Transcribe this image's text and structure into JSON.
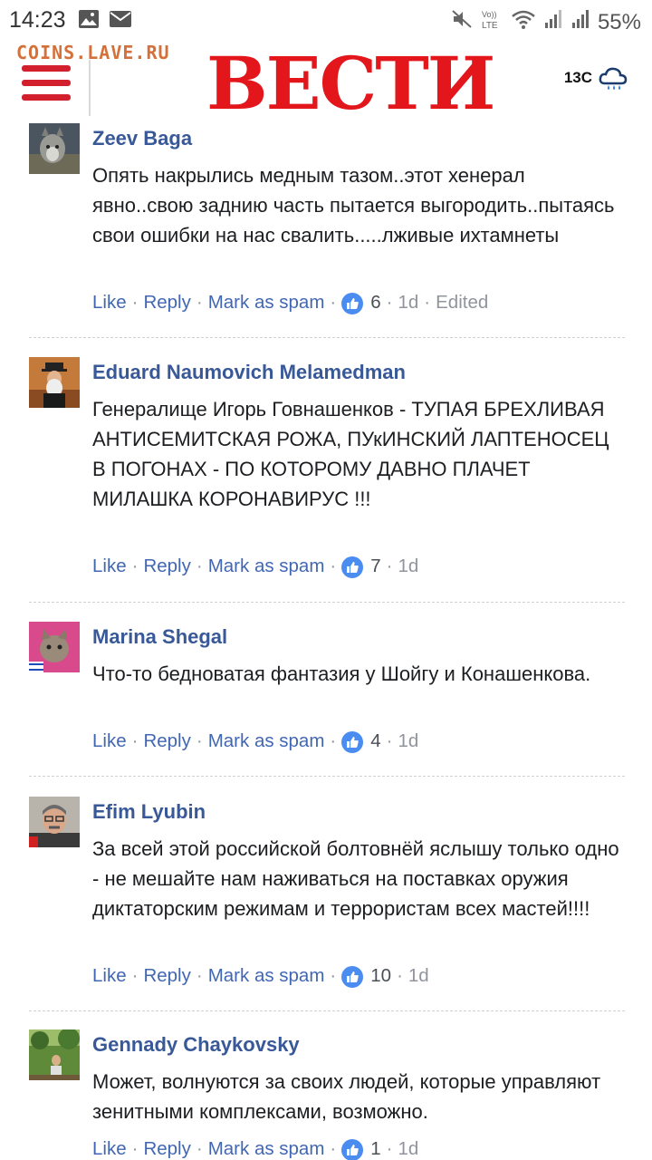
{
  "status_bar": {
    "time": "14:23",
    "battery": "55%",
    "volte": "VoLTE"
  },
  "watermark": "COINS.LAVE.RU",
  "header": {
    "logo": "ВЕСТИ",
    "weather_temp": "13C"
  },
  "actions": {
    "like": "Like",
    "reply": "Reply",
    "spam": "Mark as spam",
    "edited": "Edited"
  },
  "comments": [
    {
      "author": "Zeev Baga",
      "text": "Опять накрылись медным тазом..этот хенерал явно..свою заднию часть пытается выгородить..пытаясь свои ошибки на нас свалить.....лживые ихтамнеты",
      "likes": "6",
      "time": "1d",
      "edited": true
    },
    {
      "author": "Eduard Naumovich Melamedman",
      "text": "Генералище Игорь Говнашенков - ТУПАЯ БРЕХЛИВАЯ АНТИСЕМИТСКАЯ РОЖА, ПУкИНСКИЙ ЛАПТЕНОСЕЦ В ПОГОНАХ - ПО КОТОРОМУ ДАВНО ПЛАЧЕТ МИЛАШКА КОРОНАВИРУС !!!",
      "likes": "7",
      "time": "1d"
    },
    {
      "author": "Marina Shegal",
      "text": "Что-то бедноватая фантазия у Шойгу и Конашенкова.",
      "likes": "4",
      "time": "1d"
    },
    {
      "author": "Efim Lyubin",
      "text": "За всей этой российской болтовнёй яслышу только одно - не мешайте нам наживаться на поставках оружия диктаторским режимам и террористам всех мастей!!!!",
      "likes": "10",
      "time": "1d"
    },
    {
      "author": "Gennady Chaykovsky",
      "text": "Может, волнуются за своих людей, которые управляют зенитными комплексами, возможно.",
      "likes": "1",
      "time": "1d"
    }
  ]
}
